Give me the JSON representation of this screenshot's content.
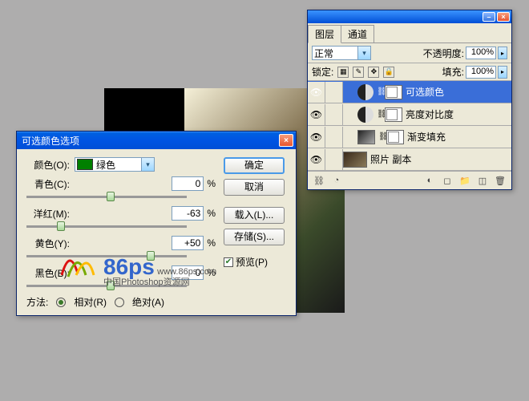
{
  "dialog": {
    "title": "可选颜色选项",
    "color_label": "颜色(O):",
    "color_value": "绿色",
    "color_swatch": "#008000",
    "sliders": {
      "cyan": {
        "label": "青色(C):",
        "value": "0",
        "pos": 50
      },
      "magenta": {
        "label": "洋红(M):",
        "value": "-63",
        "pos": 19
      },
      "yellow": {
        "label": "黄色(Y):",
        "value": "+50",
        "pos": 75
      },
      "black": {
        "label": "黑色(B):",
        "value": "0",
        "pos": 50
      }
    },
    "buttons": {
      "ok": "确定",
      "cancel": "取消",
      "load": "载入(L)...",
      "save": "存储(S)..."
    },
    "preview": "预览(P)",
    "method_label": "方法:",
    "method_rel": "相对(R)",
    "method_abs": "绝对(A)"
  },
  "panel": {
    "tabs": {
      "layers": "图层",
      "channels": "通道"
    },
    "blend": "正常",
    "opacity_label": "不透明度:",
    "opacity_value": "100%",
    "lock_label": "锁定:",
    "fill_label": "填充:",
    "fill_value": "100%",
    "layers": {
      "l1": "可选颜色",
      "l2": "亮度对比度",
      "l3": "渐变填充",
      "l4": "照片 副本"
    }
  },
  "watermark": {
    "brand": "86ps",
    "url": "www.86ps.com",
    "sub": "中国Photoshop资源网"
  }
}
